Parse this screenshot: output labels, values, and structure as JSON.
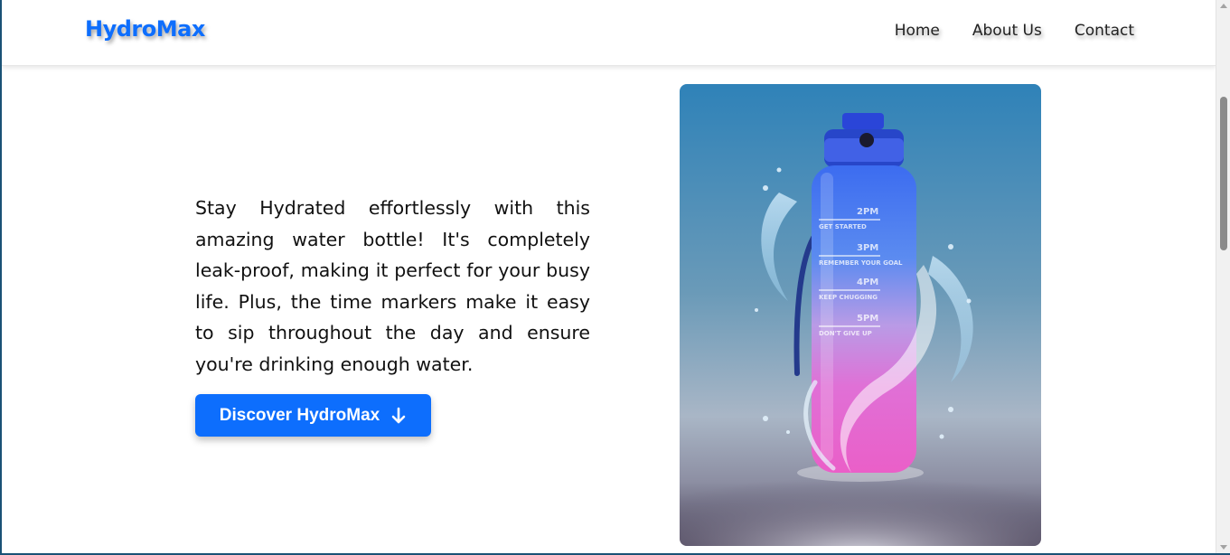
{
  "brand": {
    "name": "HydroMax",
    "color": "#0d6efd"
  },
  "nav": {
    "items": [
      {
        "label": "Home"
      },
      {
        "label": "About Us"
      },
      {
        "label": "Contact"
      }
    ]
  },
  "hero": {
    "description": "Stay Hydrated effortlessly with this amazing water bottle! It's completely leak-proof, making it perfect for your busy life. Plus, the time markers make it easy to sip throughout the day and ensure you're drinking enough water.",
    "cta_label": "Discover HydroMax",
    "cta_icon": "arrow-down-icon"
  },
  "product_image": {
    "subject": "water-bottle-splash",
    "bottle_markers": [
      {
        "time": "2PM",
        "caption": "GET STARTED"
      },
      {
        "time": "3PM",
        "caption": "REMEMBER YOUR GOAL"
      },
      {
        "time": "4PM",
        "caption": "KEEP CHUGGING"
      },
      {
        "time": "5PM",
        "caption": "DON'T GIVE UP"
      }
    ]
  }
}
